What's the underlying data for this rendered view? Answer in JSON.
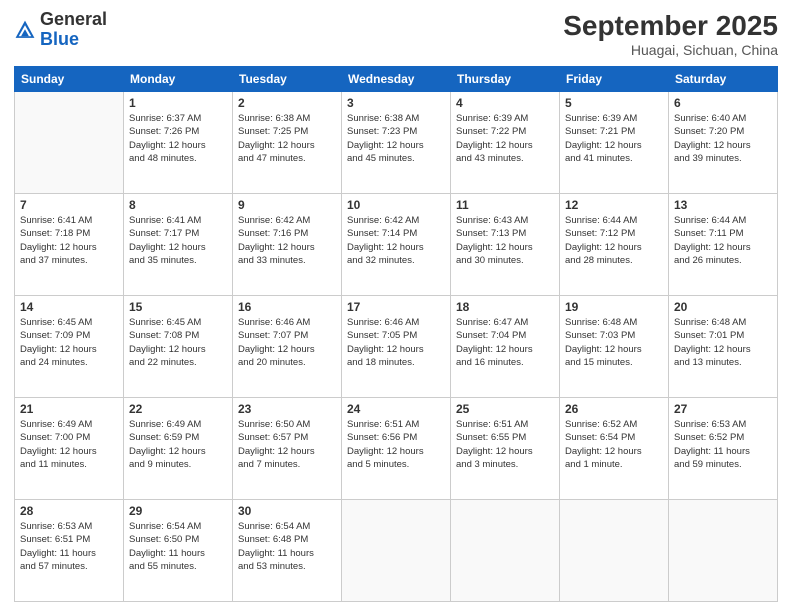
{
  "header": {
    "logo_general": "General",
    "logo_blue": "Blue",
    "month": "September 2025",
    "location": "Huagai, Sichuan, China"
  },
  "weekdays": [
    "Sunday",
    "Monday",
    "Tuesday",
    "Wednesday",
    "Thursday",
    "Friday",
    "Saturday"
  ],
  "weeks": [
    [
      {
        "day": "",
        "info": ""
      },
      {
        "day": "1",
        "info": "Sunrise: 6:37 AM\nSunset: 7:26 PM\nDaylight: 12 hours\nand 48 minutes."
      },
      {
        "day": "2",
        "info": "Sunrise: 6:38 AM\nSunset: 7:25 PM\nDaylight: 12 hours\nand 47 minutes."
      },
      {
        "day": "3",
        "info": "Sunrise: 6:38 AM\nSunset: 7:23 PM\nDaylight: 12 hours\nand 45 minutes."
      },
      {
        "day": "4",
        "info": "Sunrise: 6:39 AM\nSunset: 7:22 PM\nDaylight: 12 hours\nand 43 minutes."
      },
      {
        "day": "5",
        "info": "Sunrise: 6:39 AM\nSunset: 7:21 PM\nDaylight: 12 hours\nand 41 minutes."
      },
      {
        "day": "6",
        "info": "Sunrise: 6:40 AM\nSunset: 7:20 PM\nDaylight: 12 hours\nand 39 minutes."
      }
    ],
    [
      {
        "day": "7",
        "info": "Sunrise: 6:41 AM\nSunset: 7:18 PM\nDaylight: 12 hours\nand 37 minutes."
      },
      {
        "day": "8",
        "info": "Sunrise: 6:41 AM\nSunset: 7:17 PM\nDaylight: 12 hours\nand 35 minutes."
      },
      {
        "day": "9",
        "info": "Sunrise: 6:42 AM\nSunset: 7:16 PM\nDaylight: 12 hours\nand 33 minutes."
      },
      {
        "day": "10",
        "info": "Sunrise: 6:42 AM\nSunset: 7:14 PM\nDaylight: 12 hours\nand 32 minutes."
      },
      {
        "day": "11",
        "info": "Sunrise: 6:43 AM\nSunset: 7:13 PM\nDaylight: 12 hours\nand 30 minutes."
      },
      {
        "day": "12",
        "info": "Sunrise: 6:44 AM\nSunset: 7:12 PM\nDaylight: 12 hours\nand 28 minutes."
      },
      {
        "day": "13",
        "info": "Sunrise: 6:44 AM\nSunset: 7:11 PM\nDaylight: 12 hours\nand 26 minutes."
      }
    ],
    [
      {
        "day": "14",
        "info": "Sunrise: 6:45 AM\nSunset: 7:09 PM\nDaylight: 12 hours\nand 24 minutes."
      },
      {
        "day": "15",
        "info": "Sunrise: 6:45 AM\nSunset: 7:08 PM\nDaylight: 12 hours\nand 22 minutes."
      },
      {
        "day": "16",
        "info": "Sunrise: 6:46 AM\nSunset: 7:07 PM\nDaylight: 12 hours\nand 20 minutes."
      },
      {
        "day": "17",
        "info": "Sunrise: 6:46 AM\nSunset: 7:05 PM\nDaylight: 12 hours\nand 18 minutes."
      },
      {
        "day": "18",
        "info": "Sunrise: 6:47 AM\nSunset: 7:04 PM\nDaylight: 12 hours\nand 16 minutes."
      },
      {
        "day": "19",
        "info": "Sunrise: 6:48 AM\nSunset: 7:03 PM\nDaylight: 12 hours\nand 15 minutes."
      },
      {
        "day": "20",
        "info": "Sunrise: 6:48 AM\nSunset: 7:01 PM\nDaylight: 12 hours\nand 13 minutes."
      }
    ],
    [
      {
        "day": "21",
        "info": "Sunrise: 6:49 AM\nSunset: 7:00 PM\nDaylight: 12 hours\nand 11 minutes."
      },
      {
        "day": "22",
        "info": "Sunrise: 6:49 AM\nSunset: 6:59 PM\nDaylight: 12 hours\nand 9 minutes."
      },
      {
        "day": "23",
        "info": "Sunrise: 6:50 AM\nSunset: 6:57 PM\nDaylight: 12 hours\nand 7 minutes."
      },
      {
        "day": "24",
        "info": "Sunrise: 6:51 AM\nSunset: 6:56 PM\nDaylight: 12 hours\nand 5 minutes."
      },
      {
        "day": "25",
        "info": "Sunrise: 6:51 AM\nSunset: 6:55 PM\nDaylight: 12 hours\nand 3 minutes."
      },
      {
        "day": "26",
        "info": "Sunrise: 6:52 AM\nSunset: 6:54 PM\nDaylight: 12 hours\nand 1 minute."
      },
      {
        "day": "27",
        "info": "Sunrise: 6:53 AM\nSunset: 6:52 PM\nDaylight: 11 hours\nand 59 minutes."
      }
    ],
    [
      {
        "day": "28",
        "info": "Sunrise: 6:53 AM\nSunset: 6:51 PM\nDaylight: 11 hours\nand 57 minutes."
      },
      {
        "day": "29",
        "info": "Sunrise: 6:54 AM\nSunset: 6:50 PM\nDaylight: 11 hours\nand 55 minutes."
      },
      {
        "day": "30",
        "info": "Sunrise: 6:54 AM\nSunset: 6:48 PM\nDaylight: 11 hours\nand 53 minutes."
      },
      {
        "day": "",
        "info": ""
      },
      {
        "day": "",
        "info": ""
      },
      {
        "day": "",
        "info": ""
      },
      {
        "day": "",
        "info": ""
      }
    ]
  ]
}
